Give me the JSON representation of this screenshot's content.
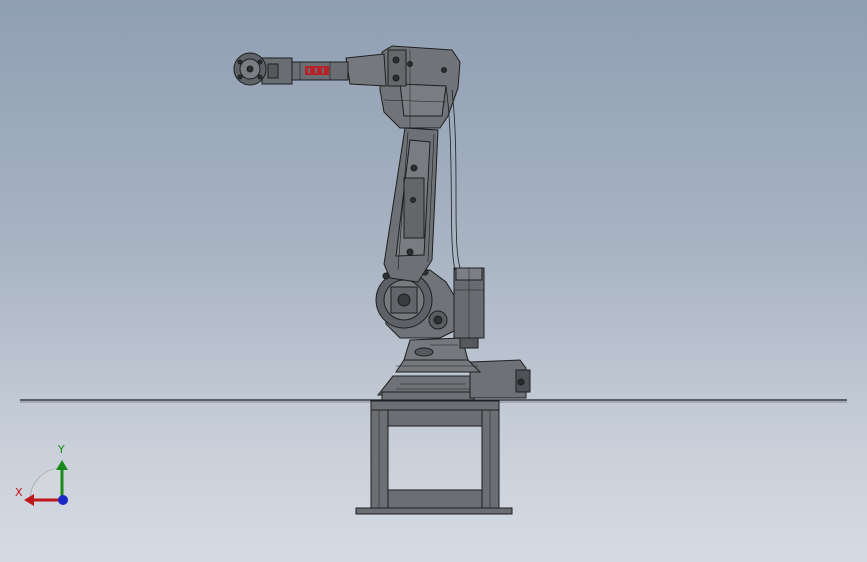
{
  "viewport": {
    "background_top": "#8f9fb2",
    "background_bottom": "#d6dbe3"
  },
  "model": {
    "name": "robot-arm-assembly",
    "body_color": "#6b6e72",
    "edge_color": "#1e1f21",
    "logo_text": "ABB",
    "logo_color": "#c4161c"
  },
  "triad": {
    "x_label": "X",
    "y_label": "Y",
    "x_color": "#c01818",
    "y_color": "#1a8a1a",
    "z_color": "#1a28c8"
  }
}
